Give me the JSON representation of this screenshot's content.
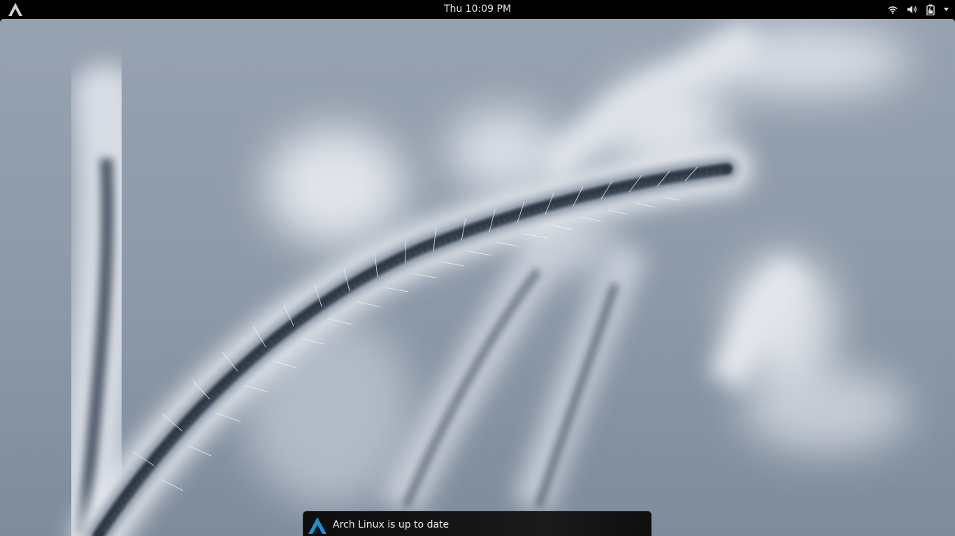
{
  "topbar": {
    "activities_icon": "arch-logo-icon",
    "clock": "Thu 10:09 PM",
    "status_icons": [
      "wifi-icon",
      "volume-icon",
      "battery-icon",
      "chevron-down-icon"
    ]
  },
  "desktop": {
    "wallpaper": "blurred grass seed head, desaturated blue-grey"
  },
  "notification": {
    "icon": "arch-logo-icon",
    "text": "Arch Linux is up to date"
  },
  "colors": {
    "topbar_bg": "#000000",
    "text": "#e8e8e8",
    "arch_blue": "#1793d1",
    "notification_bg": "#141414"
  }
}
